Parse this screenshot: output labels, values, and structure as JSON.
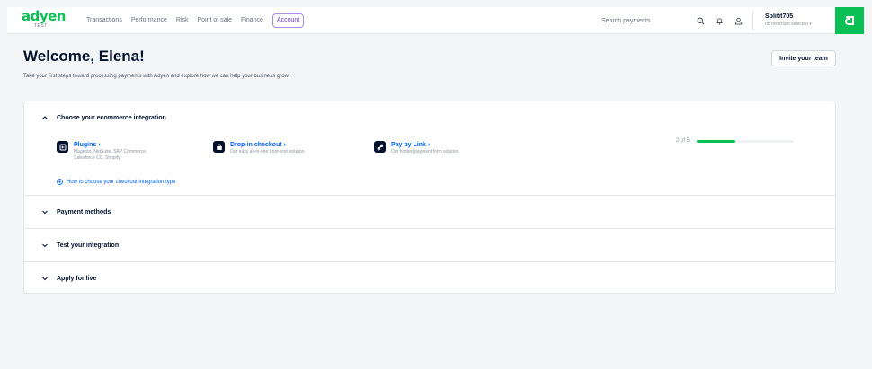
{
  "brand": {
    "logo_text": "adyen",
    "env_tag": "TEST",
    "accent": "#0abf53"
  },
  "nav": {
    "items": [
      {
        "label": "Transactions",
        "active": false
      },
      {
        "label": "Performance",
        "active": false
      },
      {
        "label": "Risk",
        "active": false
      },
      {
        "label": "Point of sale",
        "active": false
      },
      {
        "label": "Finance",
        "active": false
      },
      {
        "label": "Account",
        "active": true
      }
    ]
  },
  "search": {
    "placeholder": "Search payments",
    "icon": "search-icon"
  },
  "toolbar": {
    "notifications_icon": "bell-icon",
    "user_icon": "user-icon"
  },
  "account": {
    "name": "Splitit705",
    "merchant": "no merchant selected ▾"
  },
  "app_switcher": {
    "icon": "adyen-app-icon"
  },
  "page": {
    "welcome": "Welcome, Elena!",
    "intro": "Take your first steps toward processing payments with Adyen and explore how we can help your business grow.",
    "invite_label": "Invite your team"
  },
  "sections": [
    {
      "title": "Choose your ecommerce integration",
      "expanded": true
    },
    {
      "title": "Payment methods",
      "expanded": false
    },
    {
      "title": "Test your integration",
      "expanded": false
    },
    {
      "title": "Apply for live",
      "expanded": false
    }
  ],
  "integration_options": [
    {
      "title": "Plugins ›",
      "desc_line1": "Magento, NetSuite, SAP Commerce,",
      "desc_line2": "Salesforce CC, Shopify",
      "icon": "plugin-icon"
    },
    {
      "title": "Drop-in checkout ›",
      "desc_line1": "Our easy all-in-one front-end solution.",
      "desc_line2": "",
      "icon": "shopping-bag-icon"
    },
    {
      "title": "Pay by Link ›",
      "desc_line1": "Our hosted payment form solution.",
      "desc_line2": "",
      "icon": "link-icon"
    }
  ],
  "howto_link": "How to choose your checkout integration type",
  "test_progress": {
    "text": "2 of 5",
    "completed": 2,
    "total": 5,
    "fraction": 0.4
  }
}
